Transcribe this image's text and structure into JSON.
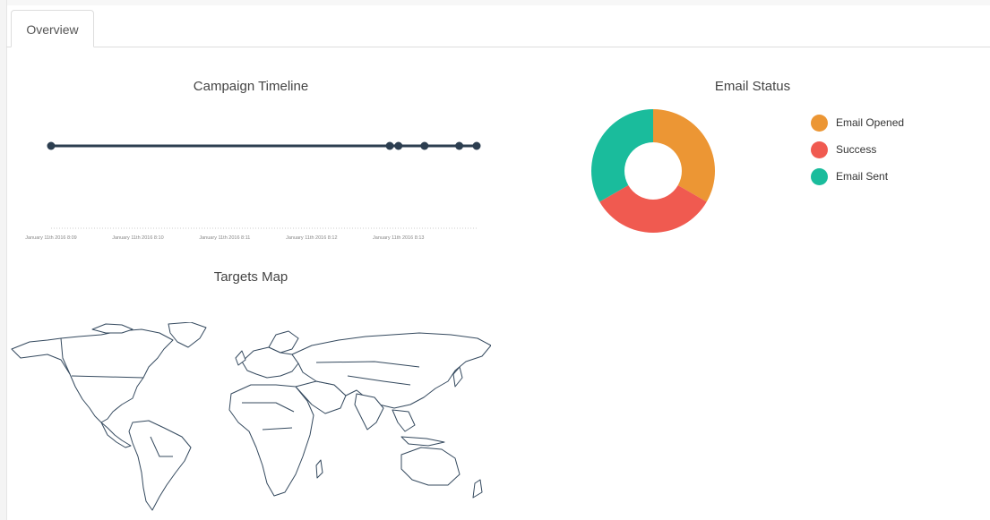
{
  "tabs": [
    {
      "label": "Overview",
      "active": true
    }
  ],
  "timeline": {
    "title": "Campaign Timeline",
    "tick_labels": [
      "January 11th 2016 8:09",
      "January 11th 2016 8:10",
      "January 11th 2016 8:11",
      "January 11th 2016 8:12",
      "January 11th 2016 8:13"
    ],
    "line_color": "#2c3e50"
  },
  "email_status": {
    "title": "Email Status",
    "legend": [
      {
        "label": "Email Opened",
        "color": "#ec9634"
      },
      {
        "label": "Success",
        "color": "#f05a50"
      },
      {
        "label": "Email Sent",
        "color": "#1abc9c"
      }
    ]
  },
  "targets_map": {
    "title": "Targets Map",
    "stroke_color": "#34495e"
  },
  "chart_data": [
    {
      "type": "scatter",
      "title": "Campaign Timeline",
      "x": [
        "January 11th 2016 8:09",
        "January 11th 2016 8:13",
        "January 11th 2016 8:13",
        "January 11th 2016 8:13",
        "January 11th 2016 8:13",
        "January 11th 2016 8:13"
      ],
      "x_numeric_minutes": [
        0,
        3.9,
        4.0,
        4.3,
        4.7,
        4.9
      ],
      "xlabel": "",
      "ylabel": ""
    },
    {
      "type": "pie",
      "title": "Email Status",
      "labels": [
        "Email Opened",
        "Success",
        "Email Sent"
      ],
      "values": [
        1,
        1,
        1
      ],
      "colors": [
        "#ec9634",
        "#f05a50",
        "#1abc9c"
      ],
      "donut": true
    }
  ]
}
